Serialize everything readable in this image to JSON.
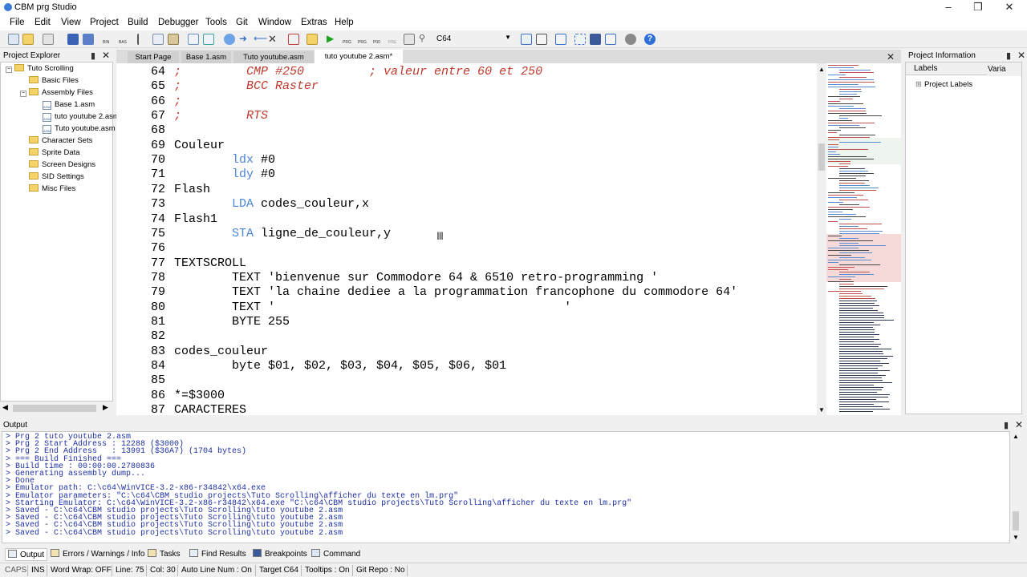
{
  "window": {
    "title": "CBM prg Studio"
  },
  "menu": [
    "File",
    "Edit",
    "View",
    "Project",
    "Build",
    "Debugger",
    "Tools",
    "Git",
    "Window",
    "Extras",
    "Help"
  ],
  "toolbar": {
    "target_combo": "C64",
    "bin_label": "BIN",
    "bas_label": "BAS",
    "prg_label": "PRG",
    "p00_label": "P00",
    "pre_label": "PRE"
  },
  "explorer": {
    "title": "Project Explorer",
    "items": [
      {
        "label": "Tuto Scrolling",
        "kind": "project"
      },
      {
        "label": "Basic Files",
        "kind": "folder"
      },
      {
        "label": "Assembly Files",
        "kind": "folder"
      },
      {
        "label": "Base 1.asm",
        "kind": "asm"
      },
      {
        "label": "tuto youtube 2.asm",
        "kind": "asm"
      },
      {
        "label": "Tuto youtube.asm",
        "kind": "asm"
      },
      {
        "label": "Character Sets",
        "kind": "folder"
      },
      {
        "label": "Sprite Data",
        "kind": "folder"
      },
      {
        "label": "Screen Designs",
        "kind": "folder"
      },
      {
        "label": "SID Settings",
        "kind": "folder"
      },
      {
        "label": "Misc Files",
        "kind": "folder"
      }
    ],
    "asm_icon_text": "ASM"
  },
  "tabs": [
    "Start Page",
    "Base 1.asm",
    "Tuto youtube.asm",
    "tuto youtube 2.asm*"
  ],
  "editor": {
    "lines": [
      {
        "n": "64",
        "parts": [
          {
            "t": ";         CMP #250         ; valeur entre 60 et 250",
            "c": "cmt"
          }
        ]
      },
      {
        "n": "65",
        "parts": [
          {
            "t": ";         BCC Raster",
            "c": "cmt"
          }
        ]
      },
      {
        "n": "66",
        "parts": [
          {
            "t": ";",
            "c": "cmt"
          }
        ]
      },
      {
        "n": "67",
        "parts": [
          {
            "t": ";         RTS",
            "c": "cmt"
          }
        ]
      },
      {
        "n": "68",
        "parts": []
      },
      {
        "n": "69",
        "parts": [
          {
            "t": "Couleur",
            "c": ""
          }
        ]
      },
      {
        "n": "70",
        "parts": [
          {
            "t": "        ",
            "c": ""
          },
          {
            "t": "ldx",
            "c": "op"
          },
          {
            "t": " #0",
            "c": ""
          }
        ]
      },
      {
        "n": "71",
        "parts": [
          {
            "t": "        ",
            "c": ""
          },
          {
            "t": "ldy",
            "c": "op"
          },
          {
            "t": " #0",
            "c": ""
          }
        ]
      },
      {
        "n": "72",
        "parts": [
          {
            "t": "Flash",
            "c": ""
          }
        ]
      },
      {
        "n": "73",
        "parts": [
          {
            "t": "        ",
            "c": ""
          },
          {
            "t": "LDA",
            "c": "op"
          },
          {
            "t": " codes_couleur,x",
            "c": ""
          }
        ]
      },
      {
        "n": "74",
        "parts": [
          {
            "t": "Flash1",
            "c": ""
          }
        ]
      },
      {
        "n": "75",
        "parts": [
          {
            "t": "        ",
            "c": ""
          },
          {
            "t": "STA",
            "c": "op"
          },
          {
            "t": " ligne_de_couleur,y",
            "c": ""
          }
        ]
      },
      {
        "n": "76",
        "parts": []
      },
      {
        "n": "77",
        "parts": [
          {
            "t": "TEXTSCROLL",
            "c": ""
          }
        ]
      },
      {
        "n": "78",
        "parts": [
          {
            "t": "        TEXT 'bienvenue sur Commodore 64 & 6510 retro-programming '",
            "c": ""
          }
        ]
      },
      {
        "n": "79",
        "parts": [
          {
            "t": "        TEXT 'la chaine dediee a la programmation francophone du commodore 64'",
            "c": ""
          }
        ]
      },
      {
        "n": "80",
        "parts": [
          {
            "t": "        TEXT '                                        '",
            "c": ""
          }
        ]
      },
      {
        "n": "81",
        "parts": [
          {
            "t": "        BYTE 255",
            "c": ""
          }
        ]
      },
      {
        "n": "82",
        "parts": []
      },
      {
        "n": "83",
        "parts": [
          {
            "t": "codes_couleur",
            "c": ""
          }
        ]
      },
      {
        "n": "84",
        "parts": [
          {
            "t": "        byte $01, $02, $03, $04, $05, $06, $01",
            "c": ""
          }
        ]
      },
      {
        "n": "85",
        "parts": []
      },
      {
        "n": "86",
        "parts": [
          {
            "t": "*=$3000",
            "c": ""
          }
        ]
      },
      {
        "n": "87",
        "parts": [
          {
            "t": "CARACTERES",
            "c": ""
          }
        ]
      }
    ]
  },
  "project_info": {
    "title": "Project Information",
    "tab_labels": "Labels",
    "tab_vars": "Varia",
    "tree_root": "Project Labels"
  },
  "output": {
    "title": "Output",
    "lines": [
      "> Prg 2 tuto youtube 2.asm",
      "> Prg 2 Start Address : 12288 ($3000)",
      "> Prg 2 End Address   : 13991 ($36A7) (1704 bytes)",
      "> === Build Finished ===",
      "> Build time : 00:00:00.2780836",
      "> Generating assembly dump...",
      "> Done",
      "> Emulator path: C:\\c64\\WinVICE-3.2-x86-r34842\\x64.exe",
      "> Emulator parameters: \"C:\\c64\\CBM studio projects\\Tuto Scrolling\\afficher du texte en lm.prg\"",
      "> Starting Emulator: C:\\c64\\WinVICE-3.2-x86-r34842\\x64.exe \"C:\\c64\\CBM studio projects\\Tuto Scrolling\\afficher du texte en lm.prg\"",
      "> Saved - C:\\c64\\CBM studio projects\\Tuto Scrolling\\tuto youtube 2.asm",
      "> Saved - C:\\c64\\CBM studio projects\\Tuto Scrolling\\tuto youtube 2.asm",
      "> Saved - C:\\c64\\CBM studio projects\\Tuto Scrolling\\tuto youtube 2.asm",
      "> Saved - C:\\c64\\CBM studio projects\\Tuto Scrolling\\tuto youtube 2.asm"
    ]
  },
  "bottom_tabs": [
    "Output",
    "Errors / Warnings / Info",
    "Tasks",
    "Find Results",
    "Breakpoints",
    "Command"
  ],
  "status": {
    "caps": "CAPS",
    "ins": "INS",
    "wordwrap": "Word Wrap: OFF",
    "line": "Line: 75",
    "col": "Col: 30",
    "autoline": "Auto Line Num : On",
    "target": "Target  C64",
    "tooltips": "Tooltips : On",
    "gitrepo": "Git Repo : No"
  },
  "colors": {
    "comment": "#c0392b",
    "opcode": "#4a86d9",
    "output_text": "#1d2fa0",
    "active_tab": "#ffffff"
  }
}
